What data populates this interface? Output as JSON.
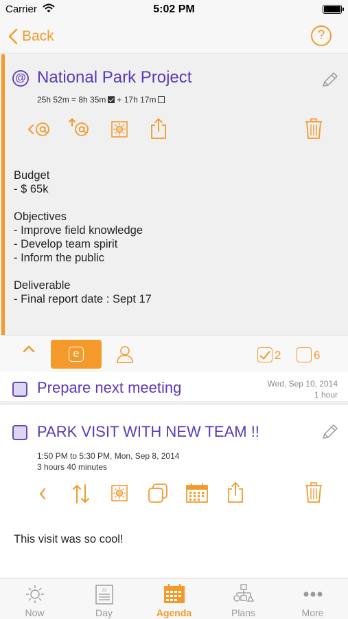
{
  "status_bar": {
    "carrier": "Carrier",
    "time": "5:02 PM"
  },
  "nav": {
    "back_label": "Back",
    "help_label": "?"
  },
  "project": {
    "at_symbol": "@",
    "title": "National Park Project",
    "time_total": "25h 52m = 8h 35m",
    "time_plus": "+ 17h 17m",
    "notes": "Budget\n- $ 65k\n\nObjectives\n- Improve field knowledge\n- Develop team spirit\n- Inform the public\n\nDeliverable\n- Final report date : Sept 17"
  },
  "toolbar": {
    "e_label": "e",
    "checked_count": "2",
    "unchecked_count": "6"
  },
  "task": {
    "title": "Prepare next meeting",
    "date": "Wed, Sep 10, 2014",
    "duration": "1 hour"
  },
  "event": {
    "title": "PARK VISIT WITH NEW TEAM !!",
    "time": "1:50 PM to 5:30 PM, Mon, Sep 8, 2014",
    "duration": "3 hours 40 minutes",
    "note": "This visit was so cool!"
  },
  "tabs": [
    {
      "label": "Now",
      "icon": "sun-icon",
      "active": false
    },
    {
      "label": "Day",
      "icon": "day-calendar-icon",
      "active": false
    },
    {
      "label": "Agenda",
      "icon": "agenda-calendar-icon",
      "active": true
    },
    {
      "label": "Plans",
      "icon": "hierarchy-icon",
      "active": false
    },
    {
      "label": "More",
      "icon": "more-dots-icon",
      "active": false
    }
  ],
  "colors": {
    "accent": "#f39a2b",
    "purple": "#5a3ab7",
    "card_bg": "#f0f0f0"
  }
}
